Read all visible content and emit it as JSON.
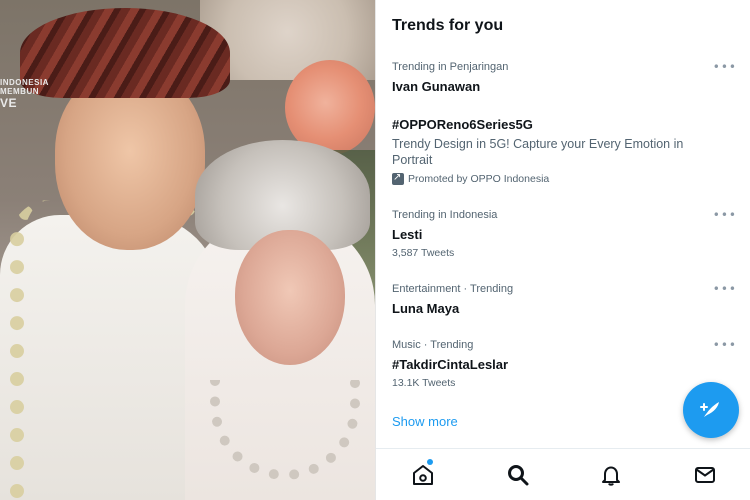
{
  "photo": {
    "watermark_line1": "INDONESIA",
    "watermark_line2": "MEMBUN",
    "watermark_line3": "VE"
  },
  "panel": {
    "title": "Trends for you",
    "more_icon": "ellipsis-icon"
  },
  "trends": [
    {
      "meta": "Trending in Penjaringan",
      "name": "Ivan Gunawan"
    },
    {
      "name": "#OPPOReno6Series5G",
      "description": "Trendy Design in 5G! Capture your Every Emotion in Portrait",
      "promoted": "Promoted by OPPO Indonesia"
    },
    {
      "meta": "Trending in Indonesia",
      "name": "Lesti",
      "count": "3,587 Tweets"
    },
    {
      "meta": "Entertainment · Trending",
      "name": "Luna Maya"
    },
    {
      "meta": "Music · Trending",
      "name": "#TakdirCintaLeslar",
      "count": "13.1K Tweets"
    }
  ],
  "show_more": "Show more",
  "fab": {
    "icon": "compose-tweet-icon"
  },
  "nav": [
    {
      "icon": "home-icon"
    },
    {
      "icon": "search-icon"
    },
    {
      "icon": "bell-icon"
    },
    {
      "icon": "mail-icon"
    }
  ],
  "colors": {
    "accent": "#1d9bf0",
    "text_primary": "#0f1419",
    "text_secondary": "#536471"
  }
}
